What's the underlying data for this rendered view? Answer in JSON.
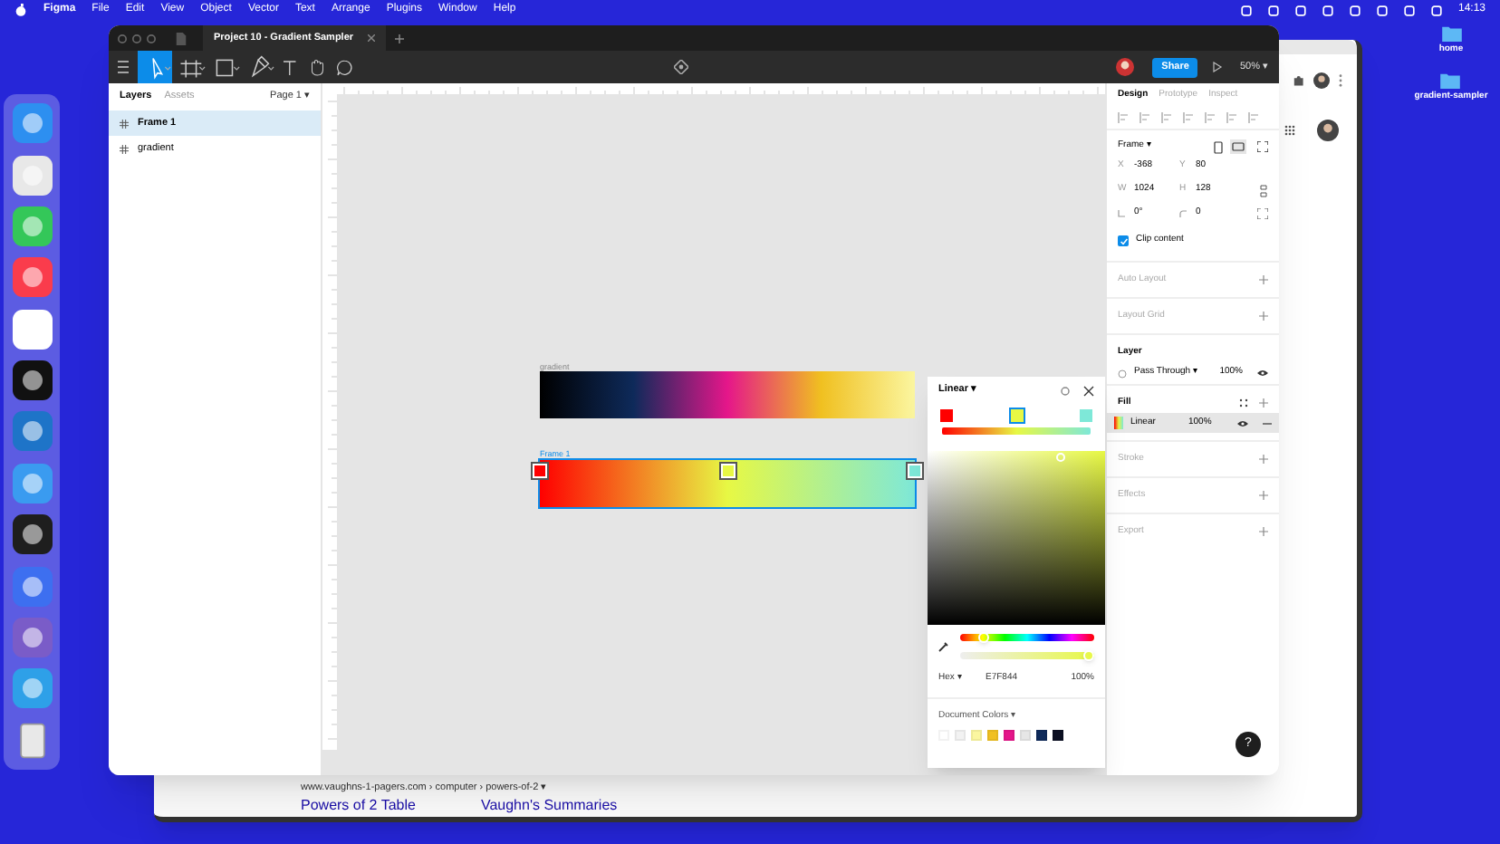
{
  "menu_bar": {
    "items": [
      "Figma",
      "File",
      "Edit",
      "View",
      "Object",
      "Vector",
      "Text",
      "Arrange",
      "Plugins",
      "Window",
      "Help"
    ],
    "clock": "14:13"
  },
  "desktop_icons": [
    {
      "label": "home"
    },
    {
      "label": "gradient-sampler"
    }
  ],
  "browser": {
    "breadcrumb": "www.vaughns-1-pagers.com › computer › powers-of-2 ▾",
    "results": [
      "Powers of 2 Table",
      "Vaughn's Summaries"
    ]
  },
  "figma": {
    "tab": "Project 10 - Gradient Sampler",
    "tools": [
      {
        "kind": "move",
        "selected": true
      },
      {
        "kind": "frame",
        "selected": false
      },
      {
        "kind": "shape",
        "selected": false
      },
      {
        "kind": "pen",
        "selected": false
      },
      {
        "kind": "text",
        "selected": false
      },
      {
        "kind": "hand",
        "selected": false
      },
      {
        "kind": "comment",
        "selected": false
      }
    ],
    "share": "Share",
    "zoom": "50% ▾"
  },
  "left_panel": {
    "tabs": [
      {
        "label": "Layers",
        "selected": true
      },
      {
        "label": "Assets",
        "selected": false
      }
    ],
    "page": "Page 1 ▾",
    "layers": [
      {
        "name": "Frame 1",
        "selected": true
      },
      {
        "name": "gradient",
        "selected": false
      }
    ]
  },
  "canvas": {
    "frames": [
      {
        "label": "gradient",
        "selected": false,
        "stops": [
          {
            "color": "#000000"
          },
          {
            "color": "#0e2a5a"
          },
          {
            "color": "#e5168a"
          },
          {
            "color": "#f0c020"
          },
          {
            "color": "#fbf6a0"
          }
        ]
      },
      {
        "label": "Frame 1",
        "selected": true,
        "stops": [
          {
            "color": "#ff0000"
          },
          {
            "color": "#e7f844"
          },
          {
            "color": "#7ee8d8"
          }
        ]
      }
    ]
  },
  "color_picker": {
    "mode": "Linear ▾",
    "stops": [
      {
        "color": "#ff0000",
        "selected": false
      },
      {
        "color": "#e7f844",
        "selected": true
      },
      {
        "color": "#7ee8d8",
        "selected": false
      }
    ],
    "hue": {
      "level": 0.17
    },
    "alpha": {
      "level": 1
    },
    "hex_label": "Hex ▾",
    "hex": "E7F844",
    "opacity": "100%",
    "document_colors": "Document Colors ▾",
    "swatches": [
      {
        "color": "#ffffff"
      },
      {
        "color": "#f2f2f2"
      },
      {
        "color": "#fbf6a0"
      },
      {
        "color": "#f0c020"
      },
      {
        "color": "#e5168a"
      },
      {
        "color": "#e6e6e6"
      },
      {
        "color": "#0e2a5a"
      },
      {
        "color": "#0b0f22"
      }
    ]
  },
  "design_panel": {
    "tabs": [
      {
        "label": "Design",
        "selected": true
      },
      {
        "label": "Prototype",
        "selected": false
      },
      {
        "label": "Inspect",
        "selected": false
      }
    ],
    "frame": "Frame ▾",
    "fields": [
      {
        "kind": "text",
        "label": "X",
        "value": "-368"
      },
      {
        "kind": "text",
        "label": "Y",
        "value": "80"
      },
      {
        "kind": "text",
        "label": "W",
        "value": "1024"
      },
      {
        "kind": "text",
        "label": "H",
        "value": "128"
      },
      {
        "kind": "rotation",
        "value": "0°"
      },
      {
        "kind": "radius",
        "value": "0"
      }
    ],
    "clip_content": {
      "label": "Clip content",
      "checked": true
    },
    "sections": [
      "Auto Layout",
      "Layout Grid"
    ],
    "layer": {
      "title": "Layer",
      "blend": "Pass Through ▾",
      "opacity": "100%"
    },
    "fill": {
      "title": "Fill",
      "type": "Linear",
      "opacity": "100%"
    },
    "more_sections": [
      "Stroke",
      "Effects",
      "Export"
    ]
  },
  "help": "?"
}
